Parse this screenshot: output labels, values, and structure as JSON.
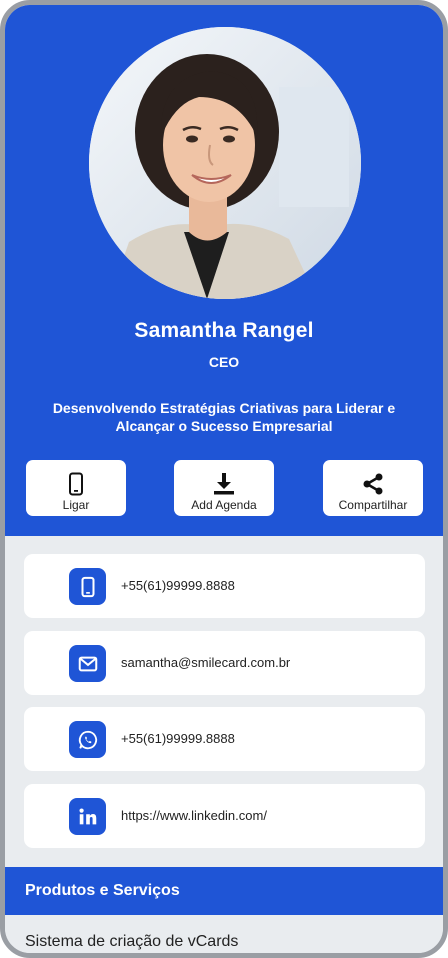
{
  "profile": {
    "name": "Samantha Rangel",
    "role": "CEO",
    "tagline": "Desenvolvendo Estratégias Criativas para Liderar e Alcançar o Sucesso Empresarial",
    "photo_alt": "Samantha Rangel"
  },
  "actions": [
    {
      "label": "Ligar",
      "icon": "phone-icon"
    },
    {
      "label": "Add Agenda",
      "icon": "download-icon"
    },
    {
      "label": "Compartilhar",
      "icon": "share-icon"
    }
  ],
  "contacts": [
    {
      "type": "phone",
      "icon": "phone-icon",
      "value": "+55(61)99999.8888"
    },
    {
      "type": "email",
      "icon": "envelope-icon",
      "value": "samantha@smilecard.com.br"
    },
    {
      "type": "whatsapp",
      "icon": "whatsapp-icon",
      "value": "+55(61)99999.8888"
    },
    {
      "type": "linkedin",
      "icon": "linkedin-icon",
      "value": "https://www.linkedin.com/"
    }
  ],
  "section": {
    "title": "Produtos e Serviços",
    "items": [
      "Sistema de criação de vCards"
    ]
  },
  "colors": {
    "brand_blue": "#1f55d6",
    "background": "#e9ecef",
    "card": "#ffffff",
    "frame": "#9a9ea4"
  }
}
